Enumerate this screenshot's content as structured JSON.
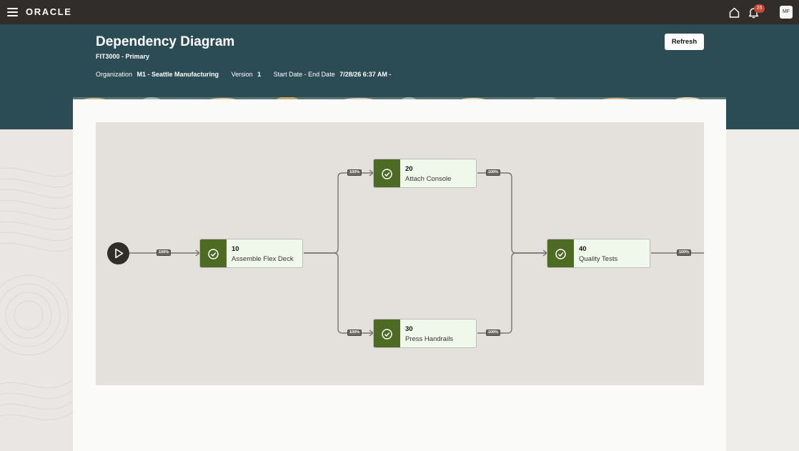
{
  "topbar": {
    "logo": "ORACLE",
    "notification_count": "25",
    "avatar_initials": "MF"
  },
  "header": {
    "title": "Dependency Diagram",
    "subtitle": "FIT3000 - Primary",
    "refresh_label": "Refresh",
    "meta": {
      "organization_label": "Organization",
      "organization_value": "M1 - Seattle Manufacturing",
      "version_label": "Version",
      "version_value": "1",
      "dates_label": "Start Date - End Date",
      "dates_value": "7/28/26 6:37 AM -"
    }
  },
  "diagram": {
    "operations": [
      {
        "number": "10",
        "name": "Assemble Flex Deck"
      },
      {
        "number": "20",
        "name": "Attach Console"
      },
      {
        "number": "30",
        "name": "Press Handrails"
      },
      {
        "number": "40",
        "name": "Quality Tests"
      }
    ],
    "link_labels": [
      "100%",
      "100%",
      "100%",
      "100%",
      "100%",
      "100%"
    ]
  },
  "colors": {
    "header_bg": "#2b4c54",
    "topbar_bg": "#312d2a",
    "op_icon_bg": "#4d6b22",
    "op_card_bg": "#f0f8eb",
    "badge_bg": "#c74634"
  },
  "icons": {
    "menu": "hamburger-icon",
    "home": "home-icon",
    "notifications": "bell-icon",
    "start": "play-icon",
    "operation_status": "check-circle-icon"
  }
}
